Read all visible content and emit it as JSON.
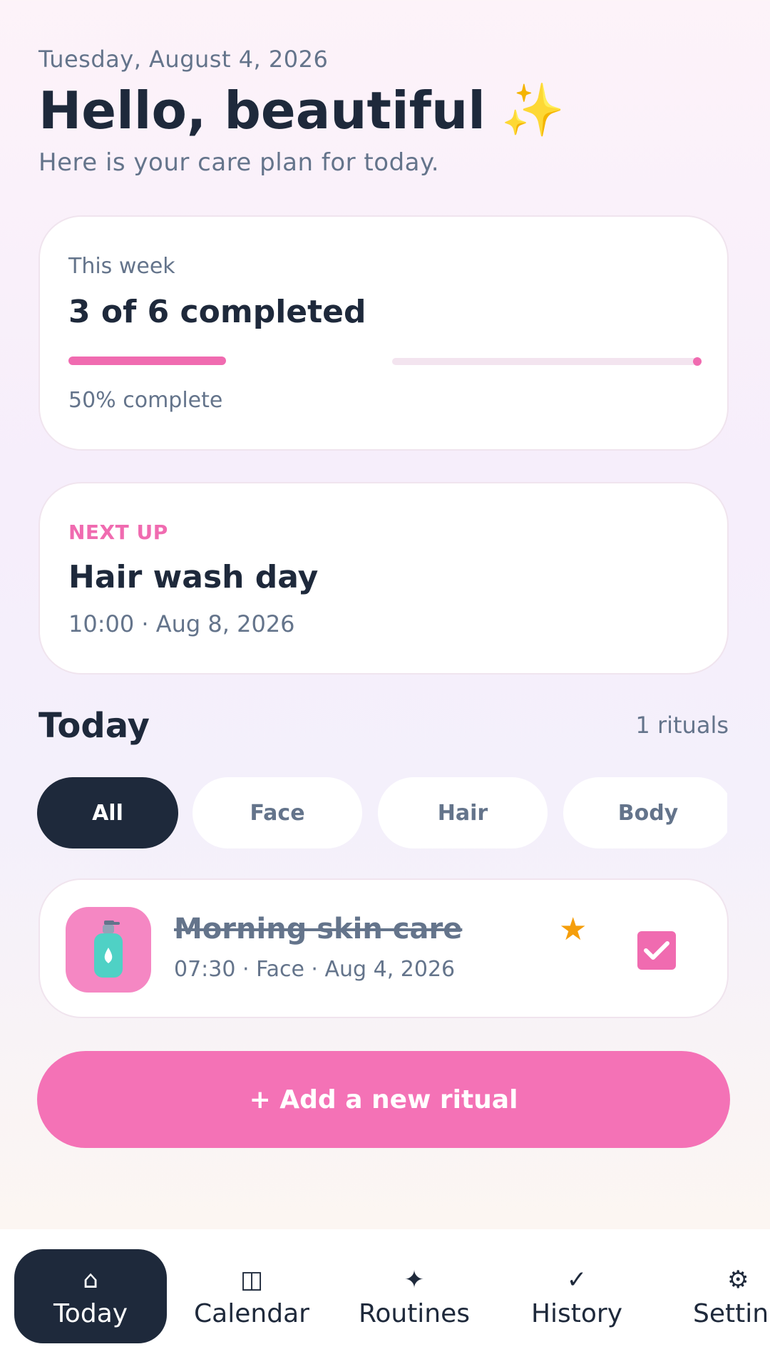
{
  "header": {
    "date": "Tuesday, August 4, 2026",
    "greeting": "Hello, beautiful",
    "greeting_emoji": "✨",
    "subtitle": "Here is your care plan for today."
  },
  "week_card": {
    "label": "This week",
    "summary": "3 of 6 completed",
    "completed": 3,
    "total": 6,
    "progress_fraction": 0.5,
    "percent_label": "50% complete",
    "accent_color": "#f06bb0"
  },
  "next_up": {
    "eyebrow": "NEXT UP",
    "title": "Hair wash day",
    "when": "10:00 · Aug 8, 2026"
  },
  "today": {
    "title": "Today",
    "count_label": "1 rituals",
    "filters": [
      {
        "label": "All",
        "active": true
      },
      {
        "label": "Face",
        "active": false
      },
      {
        "label": "Hair",
        "active": false
      },
      {
        "label": "Body",
        "active": false
      }
    ],
    "rituals": [
      {
        "name": "Morning skin care",
        "meta": "07:30 · Face · Aug 4, 2026",
        "icon": "lotion-bottle-icon",
        "favorite": true,
        "done": true
      }
    ]
  },
  "add_button": {
    "label": "+ Add a new ritual"
  },
  "tabbar": {
    "tabs": [
      {
        "label": "Today",
        "icon": "⌂",
        "icon_name": "home-icon",
        "active": true
      },
      {
        "label": "Calendar",
        "icon": "◫",
        "icon_name": "calendar-icon",
        "active": false
      },
      {
        "label": "Routines",
        "icon": "✦",
        "icon_name": "sparkle-icon",
        "active": false
      },
      {
        "label": "History",
        "icon": "✓",
        "icon_name": "check-icon",
        "active": false
      },
      {
        "label": "Settin",
        "icon": "⚙",
        "icon_name": "gear-icon",
        "active": false
      }
    ]
  },
  "colors": {
    "primary_dark": "#1e293b",
    "pink": "#f472b6",
    "muted_text": "#64748b",
    "star": "#f59e0b"
  }
}
